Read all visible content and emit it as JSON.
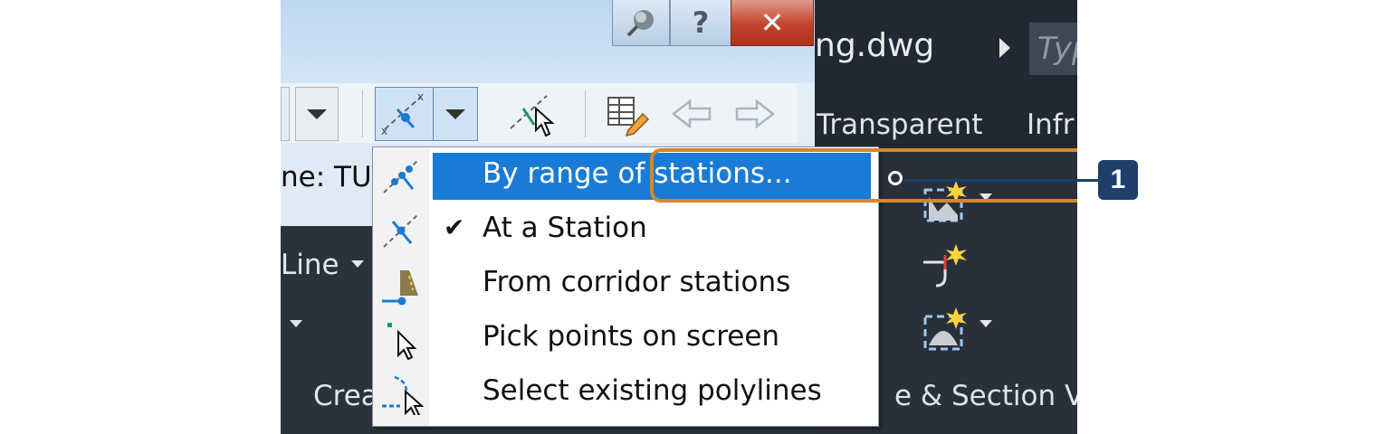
{
  "window": {
    "filename_fragment": "ng.dwg",
    "search_placeholder_fragment": "Typ",
    "tab_transparent": "Transparent",
    "tab_infr_fragment": "Infr",
    "panel_section_fragment": "e & Section Vie",
    "panel_create_fragment": "Crea",
    "line_fragment": "Line"
  },
  "dialog": {
    "name_label_fragment": "ne: TUY",
    "close_glyph": "✕",
    "help_glyph": "?"
  },
  "menu": {
    "items": [
      {
        "label": "By range of stations...",
        "checked": false,
        "highlighted": true,
        "icon": "range-stations-icon"
      },
      {
        "label": "At a Station",
        "checked": true,
        "highlighted": false,
        "icon": "at-station-icon"
      },
      {
        "label": "From corridor stations",
        "checked": false,
        "highlighted": false,
        "icon": "corridor-stations-icon"
      },
      {
        "label": "Pick points on screen",
        "checked": false,
        "highlighted": false,
        "icon": "pick-points-icon"
      },
      {
        "label": "Select existing polylines",
        "checked": false,
        "highlighted": false,
        "icon": "select-polylines-icon"
      }
    ],
    "check_glyph": "✔"
  },
  "callout": {
    "number": "1"
  },
  "colors": {
    "highlight": "#1a7bd6",
    "callout_ring": "#d6862e",
    "callout_badge": "#1d3f6a",
    "ribbon_dark": "#2b323e"
  }
}
